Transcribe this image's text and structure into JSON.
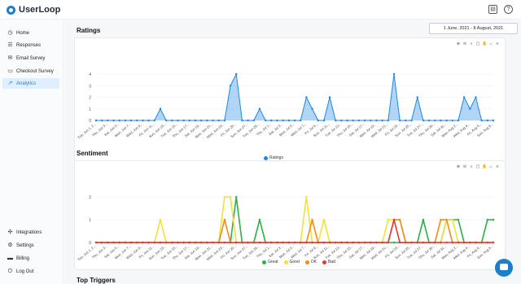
{
  "app": {
    "name": "UserLoop"
  },
  "topbar": {
    "icons": [
      "store-icon",
      "help-icon"
    ]
  },
  "sidebar": {
    "items": [
      {
        "label": "Home",
        "icon": "home-icon"
      },
      {
        "label": "Responses",
        "icon": "list-icon"
      },
      {
        "label": "Email Survey",
        "icon": "mail-icon"
      },
      {
        "label": "Checkout Survey",
        "icon": "cart-icon"
      },
      {
        "label": "Analytics",
        "icon": "trend-icon",
        "active": true
      }
    ],
    "bottom_items": [
      {
        "label": "Integrations",
        "icon": "puzzle-icon"
      },
      {
        "label": "Settings",
        "icon": "gear-icon"
      },
      {
        "label": "Billing",
        "icon": "card-icon"
      },
      {
        "label": "Log Out",
        "icon": "logout-icon"
      }
    ]
  },
  "date_range": {
    "label": "1 June, 2021 - 8 August, 2021"
  },
  "sections": {
    "ratings": "Ratings",
    "sentiment": "Sentiment",
    "triggers": "Top Triggers"
  },
  "colors": {
    "accent": "#1e7fc7",
    "ratings": "#1e88e5",
    "great": "#2bb04a",
    "good": "#f0e23c",
    "ok": "#f08c1f",
    "bad": "#e53935"
  },
  "chart_data": [
    {
      "type": "area",
      "title": "Ratings",
      "x": [
        "Tue, Jun 1, 2...",
        "Wed, Jun 2...",
        "Thu, Jun 3...",
        "Fri, Jun 4...",
        "Sat, Jun 5...",
        "Sun, Jun 6...",
        "Mon, Jun 7...",
        "Tue, Jun 8...",
        "Wed, Jun 9...",
        "Thu, Jun 1...",
        "Fri, Jun 11...",
        "Sat, Jun 12...",
        "Sun, Jun 13...",
        "Mon, Jun 14...",
        "Tue, Jun 15...",
        "Wed, Jun 16...",
        "Thu, Jun 17...",
        "Fri, Jun 18...",
        "Sat, Jun 19...",
        "Sun, Jun 20...",
        "Mon, Jun 21...",
        "Tue, Jun 22...",
        "Wed, Jun 23...",
        "Thu, Jun 24...",
        "Fri, Jun 25...",
        "Sat, Jun 26...",
        "Sun, Jun 27...",
        "Mon, Jun 28...",
        "Tue, Jun 29...",
        "Wed, Jun 30...",
        "Thu, Jul 1...",
        "Fri, Jul 2...",
        "Sat, Jul 3...",
        "Sun, Jul 4...",
        "Mon, Jul 5...",
        "Tue, Jul 6...",
        "Wed, Jul 7...",
        "Thu, Jul 8...",
        "Fri, Jul 9...",
        "Sat, Jul 10...",
        "Sun, Jul 11...",
        "Mon, Jul 12...",
        "Tue, Jul 13...",
        "Wed, Jul 14...",
        "Thu, Jul 15...",
        "Fri, Jul 16...",
        "Sat, Jul 17...",
        "Sun, Jul 18...",
        "Mon, Jul 19...",
        "Tue, Jul 20...",
        "Wed, Jul 21...",
        "Thu, Jul 22...",
        "Fri, Jul 23...",
        "Sat, Jul 24...",
        "Sun, Jul 25...",
        "Mon, Jul 26...",
        "Tue, Jul 27...",
        "Wed, Jul 28...",
        "Thu, Jul 29...",
        "Fri, Jul 30...",
        "Sat, Jul 31...",
        "Sun, Aug 1...",
        "Mon, Aug 2...",
        "Tue, Aug 3...",
        "Wed, Aug 4...",
        "Thu, Aug 5...",
        "Fri, Aug 6...",
        "Sat, Aug 7...",
        "Sun, Aug 8..."
      ],
      "series": [
        {
          "name": "Ratings",
          "values": [
            0,
            0,
            0,
            0,
            0,
            0,
            0,
            0,
            0,
            0,
            0,
            1,
            0,
            0,
            0,
            0,
            0,
            0,
            0,
            0,
            0,
            0,
            0,
            3,
            4,
            0,
            0,
            0,
            1,
            0,
            0,
            0,
            0,
            0,
            0,
            0,
            2,
            1,
            0,
            0,
            2,
            0,
            0,
            0,
            0,
            0,
            0,
            0,
            0,
            0,
            0,
            4,
            0,
            0,
            0,
            2,
            0,
            0,
            0,
            0,
            0,
            0,
            0,
            2,
            1,
            2,
            0,
            0,
            0
          ]
        }
      ],
      "ylim": [
        0,
        4
      ],
      "yticks": [
        "0",
        "1",
        "2",
        "3",
        "4"
      ],
      "legend": "bottom"
    },
    {
      "type": "line",
      "title": "Sentiment",
      "series": [
        {
          "name": "Great",
          "values": [
            0,
            0,
            0,
            0,
            0,
            0,
            0,
            0,
            0,
            0,
            0,
            0,
            0,
            0,
            0,
            0,
            0,
            0,
            0,
            0,
            0,
            0,
            0,
            0,
            2,
            0,
            0,
            0,
            1,
            0,
            0,
            0,
            0,
            0,
            0,
            0,
            0,
            0,
            0,
            0,
            0,
            0,
            0,
            0,
            0,
            0,
            0,
            0,
            0,
            0,
            0,
            0,
            0,
            0,
            0,
            0,
            1,
            0,
            0,
            0,
            1,
            1,
            1,
            0,
            0,
            0,
            0,
            1,
            1
          ]
        },
        {
          "name": "Good",
          "values": [
            0,
            0,
            0,
            0,
            0,
            0,
            0,
            0,
            0,
            0,
            0,
            1,
            0,
            0,
            0,
            0,
            0,
            0,
            0,
            0,
            0,
            0,
            2,
            2,
            0,
            0,
            0,
            0,
            0,
            0,
            0,
            0,
            0,
            0,
            0,
            0,
            2,
            0,
            0,
            1,
            0,
            0,
            0,
            0,
            0,
            0,
            0,
            0,
            0,
            0,
            1,
            1,
            1,
            0,
            0,
            0,
            0,
            0,
            0,
            0,
            1,
            1,
            0,
            0,
            0,
            0,
            0,
            0,
            0
          ]
        },
        {
          "name": "OK",
          "values": [
            0,
            0,
            0,
            0,
            0,
            0,
            0,
            0,
            0,
            0,
            0,
            0,
            0,
            0,
            0,
            0,
            0,
            0,
            0,
            0,
            0,
            0,
            1,
            0,
            0,
            0,
            0,
            0,
            0,
            0,
            0,
            0,
            0,
            0,
            0,
            0,
            0,
            1,
            0,
            0,
            0,
            0,
            0,
            0,
            0,
            0,
            0,
            0,
            0,
            0,
            0,
            1,
            1,
            0,
            0,
            0,
            0,
            0,
            0,
            1,
            1,
            0,
            0,
            0,
            0,
            0,
            0,
            0,
            0
          ]
        },
        {
          "name": "Bad",
          "values": [
            0,
            0,
            0,
            0,
            0,
            0,
            0,
            0,
            0,
            0,
            0,
            0,
            0,
            0,
            0,
            0,
            0,
            0,
            0,
            0,
            0,
            0,
            0,
            0,
            0,
            0,
            0,
            0,
            0,
            0,
            0,
            0,
            0,
            0,
            0,
            0,
            0,
            0,
            0,
            0,
            0,
            0,
            0,
            0,
            0,
            0,
            0,
            0,
            0,
            0,
            0,
            1,
            0,
            0,
            0,
            0,
            0,
            0,
            0,
            0,
            0,
            0,
            0,
            0,
            0,
            0,
            0,
            0,
            0
          ]
        }
      ],
      "ylim": [
        0,
        2
      ],
      "yticks": [
        "0",
        "1",
        "2"
      ],
      "legend": "bottom"
    }
  ]
}
